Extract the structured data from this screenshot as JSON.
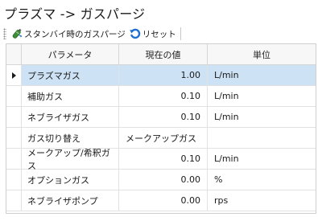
{
  "panel": {
    "title": "プラズマ -> ガスパージ"
  },
  "toolbar": {
    "standby_purge_label": "スタンバイ時のガスパージ",
    "reset_label": "リセット",
    "standby_icon": "gas-bottle-icon",
    "reset_icon": "refresh-icon",
    "accent_color": "#1e6fd0"
  },
  "grid": {
    "columns": [
      "パラメータ",
      "現在の値",
      "単位"
    ],
    "selected_row": 0,
    "rows": [
      {
        "name": "プラズマガス",
        "value": "1.00",
        "unit": "L/min"
      },
      {
        "name": "補助ガス",
        "value": "0.10",
        "unit": "L/min"
      },
      {
        "name": "ネブライザガス",
        "value": "0.10",
        "unit": "L/min"
      },
      {
        "name": "ガス切り替え",
        "value": "メークアップガス",
        "unit": ""
      },
      {
        "name": "メークアップ/希釈ガス",
        "value": "0.10",
        "unit": "L/min"
      },
      {
        "name": "オプションガス",
        "value": "0.00",
        "unit": "%"
      },
      {
        "name": "ネブライザポンプ",
        "value": "0.00",
        "unit": "rps"
      }
    ],
    "selection_color": "#cde3f5"
  }
}
